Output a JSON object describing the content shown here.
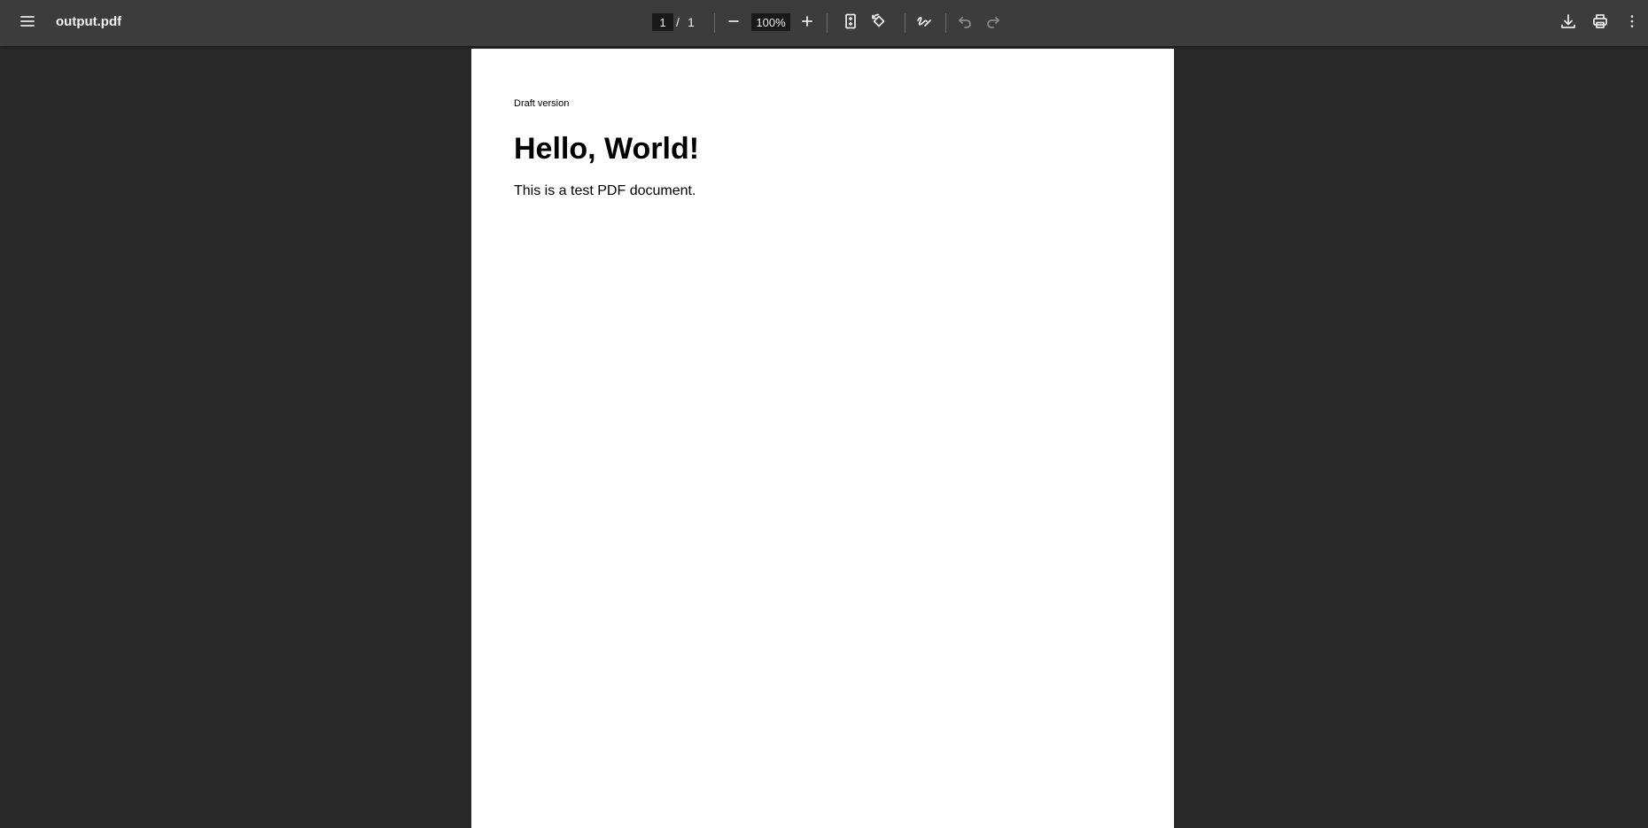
{
  "toolbar": {
    "menu_icon": "hamburger-menu-icon",
    "title": "output.pdf",
    "page_current": "1",
    "page_separator": "/",
    "page_total": "1",
    "zoom_value": "100%",
    "icons": {
      "zoom_out": "minus-icon",
      "zoom_in": "plus-icon",
      "fit_page": "fit-to-page-icon",
      "rotate": "rotate-counterclockwise-icon",
      "annotate": "draw-annotation-icon",
      "undo": "undo-icon",
      "redo": "redo-icon",
      "download": "download-icon",
      "print": "print-icon",
      "more": "more-vertical-icon"
    }
  },
  "document": {
    "draft_label": "Draft version",
    "heading": "Hello, World!",
    "paragraph": "This is a test PDF document."
  },
  "colors": {
    "toolbar_bg": "#3c3c3c",
    "viewer_bg": "#282828",
    "page_bg": "#ffffff"
  }
}
